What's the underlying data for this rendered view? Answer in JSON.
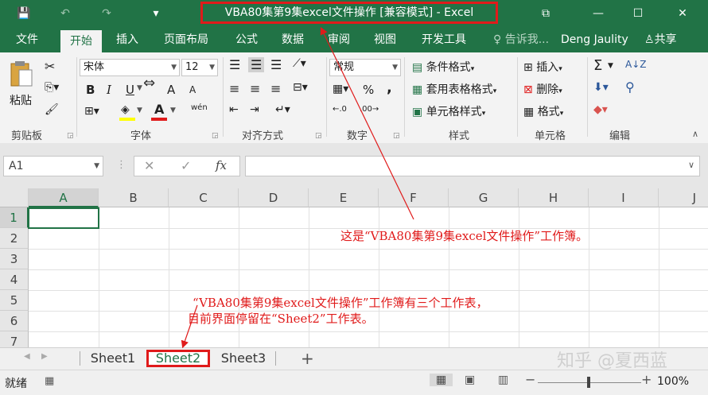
{
  "window": {
    "title": "VBA80集第9集excel文件操作  [兼容模式] - Excel",
    "save_icon": "💾",
    "undo_icon": "↶",
    "redo_icon": "↷",
    "qat_more": "▾",
    "restore_icon": "⧉",
    "minimize_icon": "—",
    "maximize_icon": "☐",
    "close_icon": "✕"
  },
  "ribbon_tabs": [
    "文件",
    "开始",
    "插入",
    "页面布局",
    "公式",
    "数据",
    "审阅",
    "视图",
    "开发工具"
  ],
  "tell_me": "告诉我...",
  "user_name": "Deng Jaulity",
  "share_label": "共享",
  "ribbon": {
    "clipboard": {
      "paste": "粘贴",
      "label": "剪贴板"
    },
    "font": {
      "name": "宋体",
      "size": "12",
      "bold": "B",
      "italic": "I",
      "underline": "U",
      "grow": "A",
      "shrink": "A",
      "label": "字体",
      "font_color": "A",
      "wen": "wén"
    },
    "alignment": {
      "label": "对齐方式"
    },
    "number": {
      "format": "常规",
      "percent": "%",
      "comma": ",",
      "label": "数字",
      "inc": "←.0",
      "dec": ".00→"
    },
    "styles": {
      "conditional": "条件格式",
      "table": "套用表格格式",
      "cell": "单元格样式",
      "label": "样式"
    },
    "cells": {
      "insert": "插入",
      "delete": "删除",
      "format": "格式",
      "label": "单元格"
    },
    "editing": {
      "sum": "Σ",
      "sort": "A↓Z",
      "find": "⚲",
      "label": "编辑"
    }
  },
  "formula_bar": {
    "name_box": "A1",
    "cancel": "✕",
    "enter": "✓",
    "fx": "fx",
    "value": ""
  },
  "columns": [
    "A",
    "B",
    "C",
    "D",
    "E",
    "F",
    "G",
    "H",
    "I",
    "J"
  ],
  "rows": [
    "1",
    "2",
    "3",
    "4",
    "5",
    "6",
    "7"
  ],
  "sheets": [
    "Sheet1",
    "Sheet2",
    "Sheet3"
  ],
  "active_sheet": "Sheet2",
  "add_sheet": "+",
  "status": {
    "ready": "就绪",
    "zoom": "100%",
    "zoom_minus": "−",
    "zoom_plus": "+"
  },
  "annotations": {
    "workbook": "这是“VBA80集第9集excel文件操作”工作簿。",
    "sheets_line1": "“VBA80集第9集excel文件操作”工作簿有三个工作表，",
    "sheets_line2": "目前界面停留在“Sheet2”工作表。"
  },
  "watermark": "知乎 @夏西蓝",
  "colors": {
    "excel_green": "#217346",
    "annotation_red": "#e01b1b"
  }
}
